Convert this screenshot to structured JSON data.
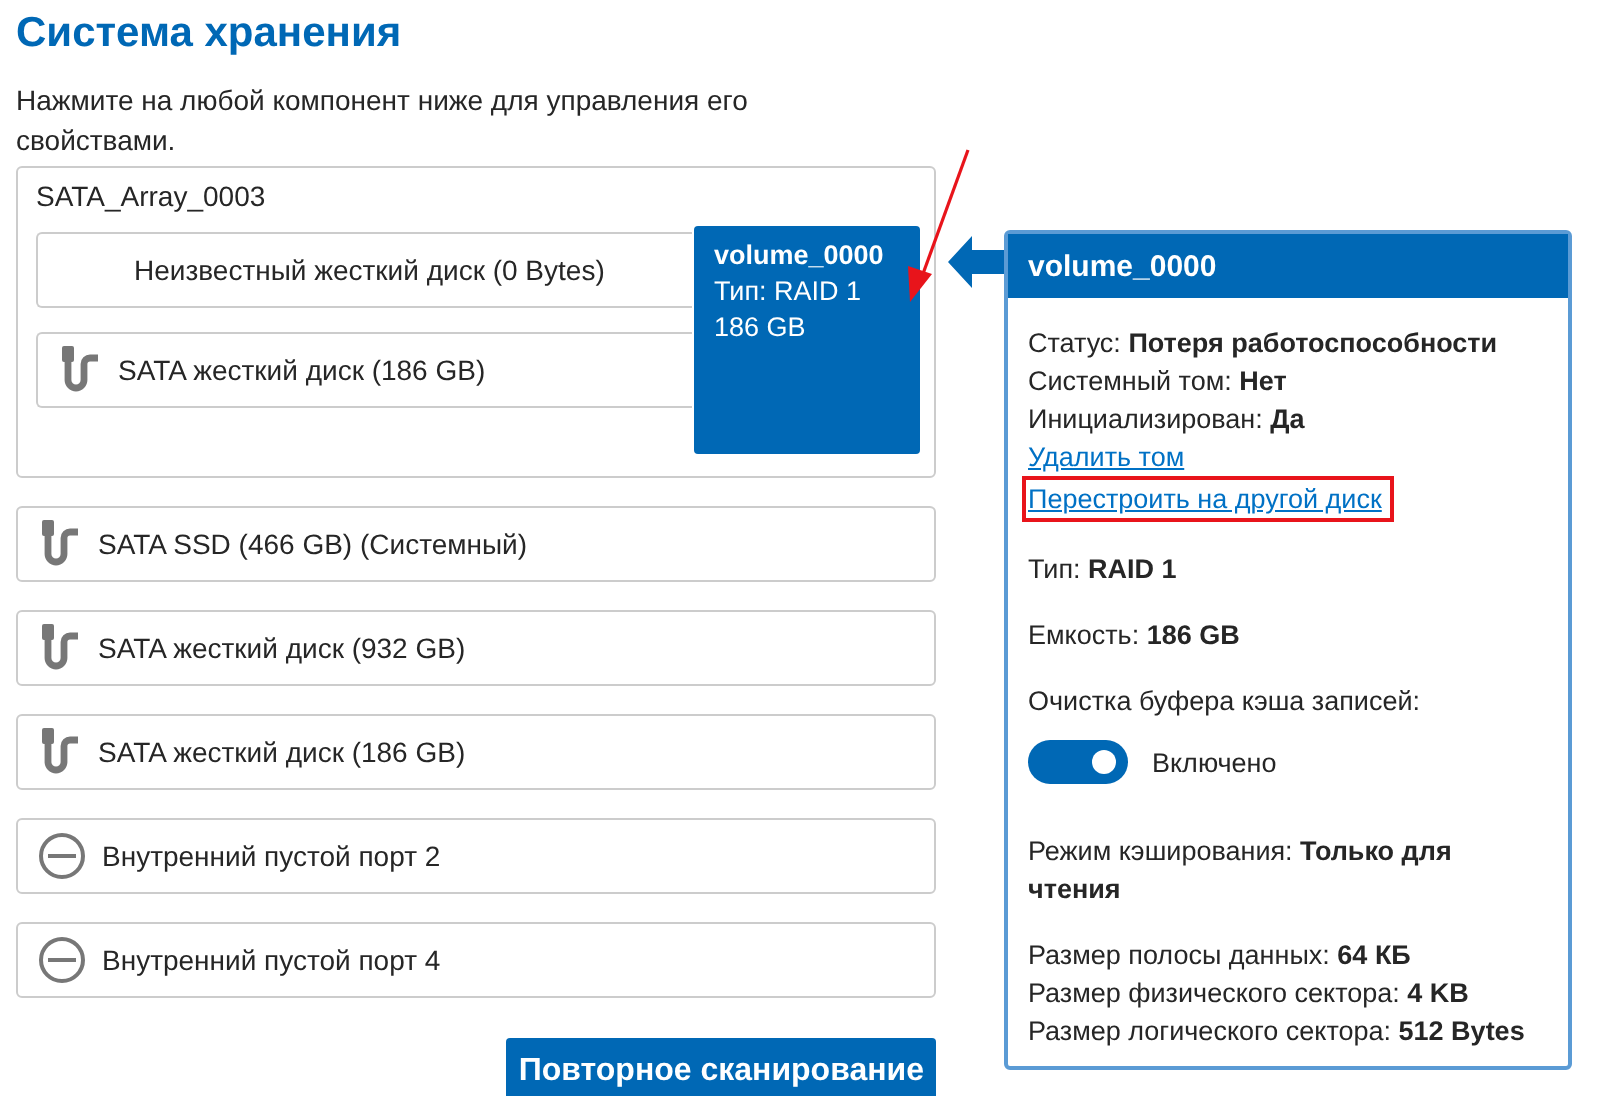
{
  "title": "Система хранения",
  "description": "Нажмите на любой компонент ниже для управления его свойствами.",
  "array": {
    "name": "SATA_Array_0003",
    "disks": [
      {
        "kind": "unknown",
        "label": "Неизвестный жесткий диск (0 Bytes)"
      },
      {
        "kind": "sata",
        "label": "SATA жесткий диск (186 GB)"
      }
    ],
    "volume": {
      "name": "volume_0000",
      "type": "Тип: RAID 1",
      "size": "186 GB"
    }
  },
  "disks": [
    {
      "kind": "sata",
      "label": "SATA SSD (466 GB) (Системный)"
    },
    {
      "kind": "sata",
      "label": "SATA жесткий диск (932 GB)"
    },
    {
      "kind": "sata",
      "label": "SATA жесткий диск (186 GB)"
    },
    {
      "kind": "empty",
      "label": "Внутренний пустой порт 2"
    },
    {
      "kind": "empty",
      "label": "Внутренний пустой порт 4"
    }
  ],
  "rescan_button": "Повторное сканирование",
  "panel": {
    "title": "volume_0000",
    "status_fields": [
      {
        "label": "Статус:",
        "value": "Потеря работоспособности"
      },
      {
        "label": "Системный том:",
        "value": "Нет"
      },
      {
        "label": "Инициализирован:",
        "value": "Да"
      }
    ],
    "actions": [
      {
        "label": "Удалить том",
        "highlighted": false
      },
      {
        "label": "Перестроить на другой диск",
        "highlighted": true
      }
    ],
    "type": {
      "label": "Тип:",
      "value": "RAID 1"
    },
    "capacity": {
      "label": "Емкость:",
      "value": "186 GB"
    },
    "write_cache": {
      "label": "Очистка буфера кэша записей:",
      "on": true,
      "state_text": "Включено"
    },
    "cache_mode": {
      "label": "Режим кэширования:",
      "value": "Только для чтения"
    },
    "sizes": [
      {
        "label": "Размер полосы данных:",
        "value": "64 КБ"
      },
      {
        "label": "Размер физического сектора:",
        "value": "4 KB"
      },
      {
        "label": "Размер логического сектора:",
        "value": "512 Bytes"
      }
    ]
  }
}
